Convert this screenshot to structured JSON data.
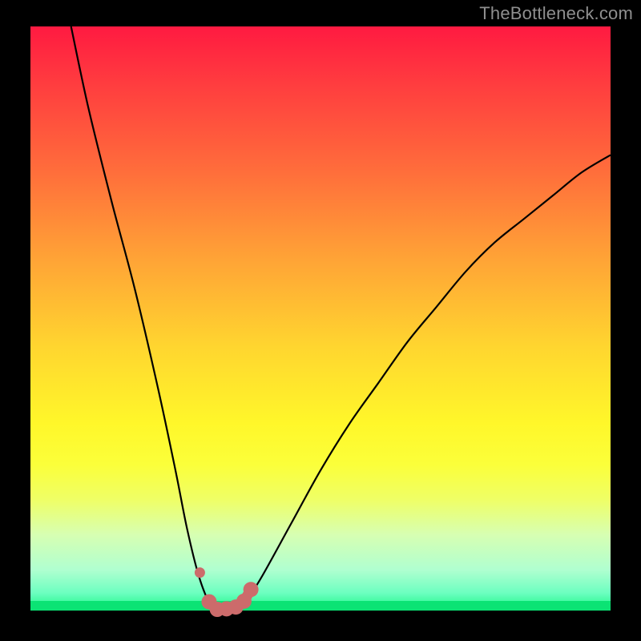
{
  "watermark": "TheBottleneck.com",
  "colors": {
    "frame": "#000000",
    "curve": "#000000",
    "necklace": "#cc6b6b",
    "gradient_top": "#ff1a41",
    "gradient_bottom": "#18f583"
  },
  "chart_data": {
    "type": "line",
    "title": "",
    "xlabel": "",
    "ylabel": "",
    "xlim": [
      0,
      100
    ],
    "ylim": [
      0,
      100
    ],
    "grid": false,
    "legend": false,
    "series": [
      {
        "name": "bottleneck-curve",
        "x": [
          7,
          10,
          14,
          18,
          22,
          25,
          27,
          29,
          31,
          32.5,
          34,
          36,
          38,
          40,
          45,
          50,
          55,
          60,
          65,
          70,
          75,
          80,
          85,
          90,
          95,
          100
        ],
        "y": [
          100,
          86,
          70,
          55,
          38,
          24,
          14,
          6,
          1,
          0,
          0,
          1,
          3,
          6,
          15,
          24,
          32,
          39,
          46,
          52,
          58,
          63,
          67,
          71,
          75,
          78
        ]
      }
    ],
    "necklace_points": {
      "x": [
        29.2,
        30.8,
        32.2,
        33.8,
        35.4,
        36.8,
        38.0
      ],
      "y": [
        6.5,
        1.5,
        0.2,
        0.3,
        0.6,
        1.6,
        3.6
      ]
    },
    "optimum_x": 33
  }
}
